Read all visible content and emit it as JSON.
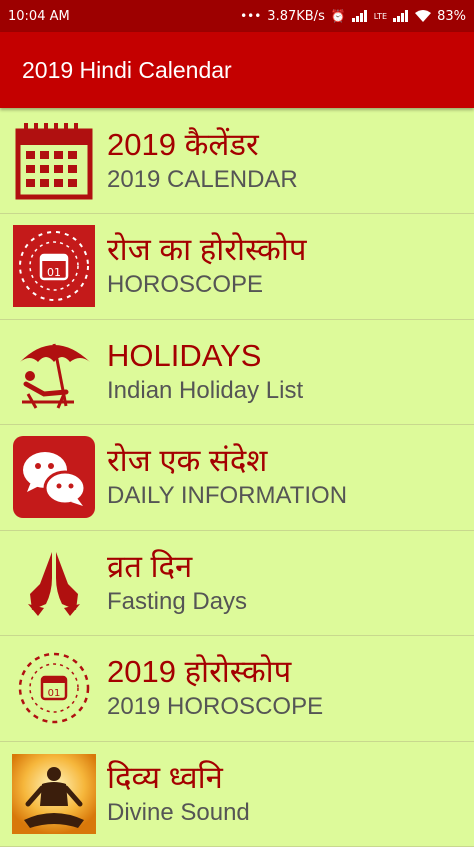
{
  "status_bar": {
    "time": "10:04 AM",
    "speed": "3.87KB/s",
    "battery": "83%"
  },
  "app_bar": {
    "title": "2019 Hindi Calendar"
  },
  "menu": [
    {
      "title": "2019 कैलेंडर",
      "subtitle": "2019 CALENDAR",
      "icon": "calendar-icon"
    },
    {
      "title": "रोज का होरोस्कोप",
      "subtitle": "HOROSCOPE",
      "icon": "zodiac-calendar-icon"
    },
    {
      "title": "HOLIDAYS",
      "subtitle": "Indian Holiday List",
      "icon": "beach-umbrella-icon"
    },
    {
      "title": "रोज एक संदेश",
      "subtitle": "DAILY INFORMATION",
      "icon": "chat-bubbles-icon"
    },
    {
      "title": "व्रत दिन",
      "subtitle": "Fasting Days",
      "icon": "praying-hands-icon"
    },
    {
      "title": "2019 होरोस्कोप",
      "subtitle": "2019 HOROSCOPE",
      "icon": "zodiac-wheel-icon"
    },
    {
      "title": "दिव्य ध्वनि",
      "subtitle": "Divine Sound",
      "icon": "meditation-icon"
    }
  ],
  "colors": {
    "status_bar": "#9d0000",
    "app_bar": "#c40000",
    "background": "#ddfa9a",
    "title_text": "#a40000",
    "subtitle_text": "#555555"
  }
}
